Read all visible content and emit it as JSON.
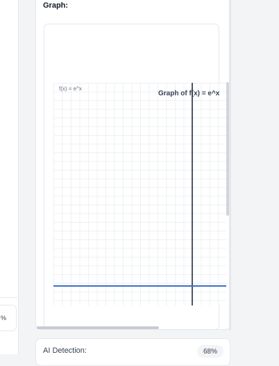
{
  "left_panel": {
    "badge_text": "%"
  },
  "graph_section": {
    "title": "Graph:",
    "function_label": "f(x) = e^x",
    "graph_title": "Graph of f(x) = e^x"
  },
  "ai_detection": {
    "label": "AI Detection:",
    "value": "68%"
  },
  "colors": {
    "curve": "#3b6fc4",
    "axis": "#4b5563",
    "grid": "#eef0f3"
  }
}
